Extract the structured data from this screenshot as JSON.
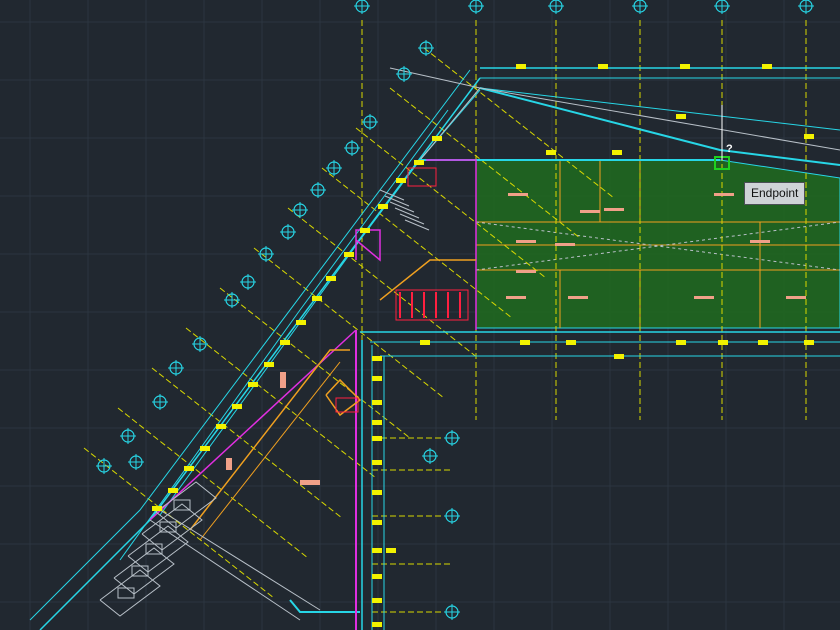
{
  "viewport": {
    "background": "#212830",
    "grid_color": "#2c3540"
  },
  "snap": {
    "tooltip_label": "Endpoint",
    "cursor_hint": "?",
    "marker_color": "#1fd11f"
  },
  "colors": {
    "wall_cyan": "#27d6e6",
    "axis_yellow": "#d8d800",
    "tag_yellow": "#f2f200",
    "room_fill": "#1f6b1f",
    "wall_orange": "#f0a020",
    "wall_magenta": "#e02fe0",
    "wall_red": "#ff2040",
    "light_grey": "#b8c0c8",
    "salmon": "#f0a088"
  },
  "icons": {
    "axis_bubble": "circle-crosshair-icon",
    "snap_marker": "endpoint-square-icon"
  }
}
